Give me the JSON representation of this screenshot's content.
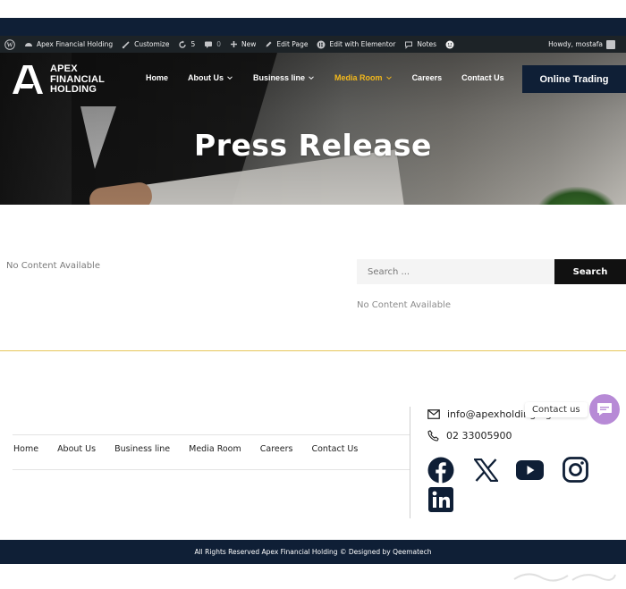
{
  "admin_bar": {
    "site_name": "Apex Financial Holding",
    "customize": "Customize",
    "updates_count": "5",
    "comments_count": "0",
    "new": "New",
    "edit_page": "Edit Page",
    "edit_elementor": "Edit with Elementor",
    "notes": "Notes",
    "howdy": "Howdy, mostafa"
  },
  "header": {
    "logo_line1": "APEX",
    "logo_line2": "FINANCIAL",
    "logo_line3": "HOLDING",
    "nav": [
      "Home",
      "About Us",
      "Business line",
      "Media Room",
      "Careers",
      "Contact Us"
    ],
    "active_nav": "Media Room",
    "cta": "Online Trading"
  },
  "hero": {
    "title": "Press Release"
  },
  "content": {
    "empty_left": "No Content Available",
    "search_placeholder": "Search ...",
    "search_button": "Search",
    "empty_right": "No Content Available"
  },
  "footer": {
    "nav": [
      "Home",
      "About Us",
      "Business line",
      "Media Room",
      "Careers",
      "Contact Us"
    ],
    "email": "info@apexholding-eg.com",
    "phone": "02 33005900",
    "contact_us": "Contact us",
    "social": [
      "facebook-icon",
      "x-icon",
      "youtube-icon",
      "instagram-icon",
      "linkedin-icon"
    ],
    "copyright": "All Rights Reserved Apex Financial Holding © Designed by  Qeematech"
  },
  "colors": {
    "navy": "#0f1f36",
    "accent": "#f2b81c",
    "chat": "#b78ad6",
    "admin_bar": "#1d2327"
  }
}
